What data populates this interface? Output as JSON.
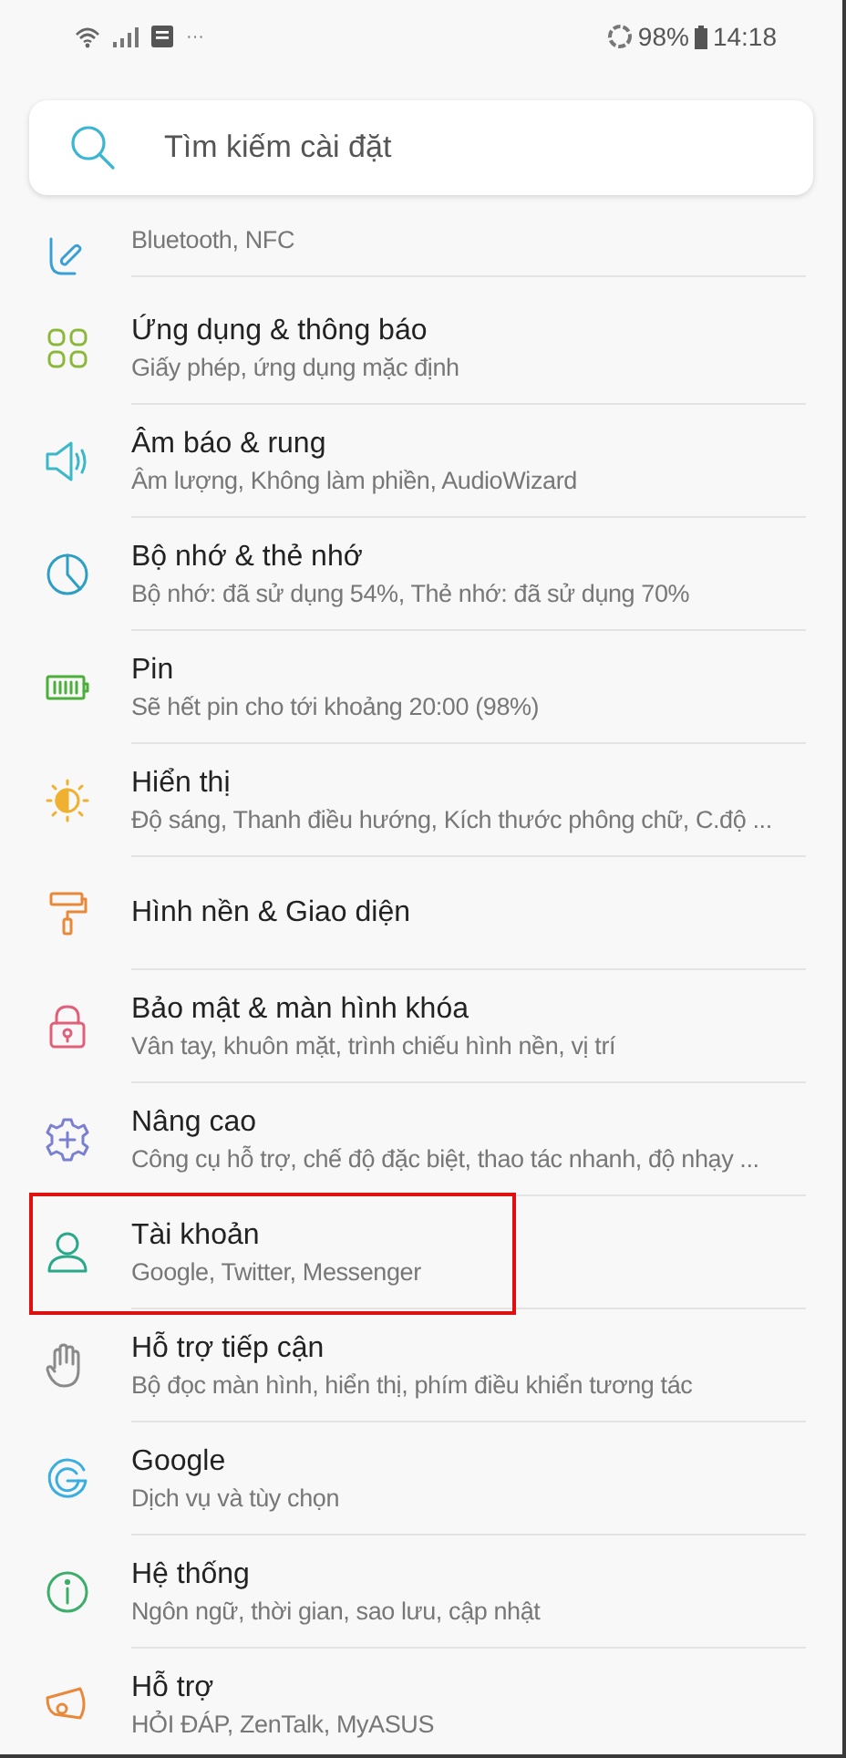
{
  "status_bar": {
    "more": "···",
    "battery": "98%",
    "time": "14:18"
  },
  "search": {
    "placeholder": "Tìm kiếm cài đặt"
  },
  "items": [
    {
      "kind": "link",
      "color": "#3a9fd6",
      "subtitle": "Bluetooth, NFC",
      "highlighted": false
    },
    {
      "kind": "apps",
      "color": "#8bb83a",
      "title": "Ứng dụng & thông báo",
      "subtitle": "Giấy phép, ứng dụng mặc định",
      "highlighted": false
    },
    {
      "kind": "sound",
      "color": "#3cb8c8",
      "title": "Âm báo & rung",
      "subtitle": "Âm lượng, Không làm phiền, AudioWizard",
      "highlighted": false
    },
    {
      "kind": "storage",
      "color": "#2e9fc4",
      "title": "Bộ nhớ & thẻ nhớ",
      "subtitle": "Bộ nhớ: đã sử dụng 54%, Thẻ nhớ: đã sử dụng 70%",
      "highlighted": false
    },
    {
      "kind": "battery",
      "color": "#4caf3a",
      "title": "Pin",
      "subtitle": "Sẽ hết pin cho tới khoảng 20:00 (98%)",
      "highlighted": false
    },
    {
      "kind": "display",
      "color": "#f0b030",
      "title": "Hiển thị",
      "subtitle": "Độ sáng, Thanh điều hướng, Kích thước phông chữ, C.độ ...",
      "highlighted": false
    },
    {
      "kind": "roller",
      "color": "#e8893a",
      "title": "Hình nền & Giao diện",
      "highlighted": false
    },
    {
      "kind": "lock",
      "color": "#e0607a",
      "title": "Bảo mật & màn hình khóa",
      "subtitle": "Vân tay, khuôn mặt, trình chiếu hình nền, vị trí",
      "highlighted": false
    },
    {
      "kind": "gear",
      "color": "#7a7fd0",
      "title": "Nâng cao",
      "subtitle": "Công cụ hỗ trợ, chế độ đặc biệt, thao tác nhanh, độ nhạy ...",
      "highlighted": false
    },
    {
      "kind": "person",
      "color": "#2aa88a",
      "title": "Tài khoản",
      "subtitle": "Google, Twitter, Messenger",
      "highlighted": true
    },
    {
      "kind": "hand",
      "color": "#8a8a8a",
      "title": "Hỗ trợ tiếp cận",
      "subtitle": "Bộ đọc màn hình, hiển thị, phím điều khiển tương tác",
      "highlighted": false
    },
    {
      "kind": "g",
      "color": "#3aaee0",
      "title": "Google",
      "subtitle": "Dịch vụ và tùy chọn",
      "highlighted": false
    },
    {
      "kind": "info",
      "color": "#3cae6a",
      "title": "Hệ thống",
      "subtitle": "Ngôn ngữ, thời gian, sao lưu, cập nhật",
      "highlighted": false
    },
    {
      "kind": "megaphone",
      "color": "#e8893a",
      "title": "Hỗ trợ",
      "subtitle": "HỎI ĐÁP, ZenTalk, MyASUS",
      "highlighted": false
    }
  ]
}
